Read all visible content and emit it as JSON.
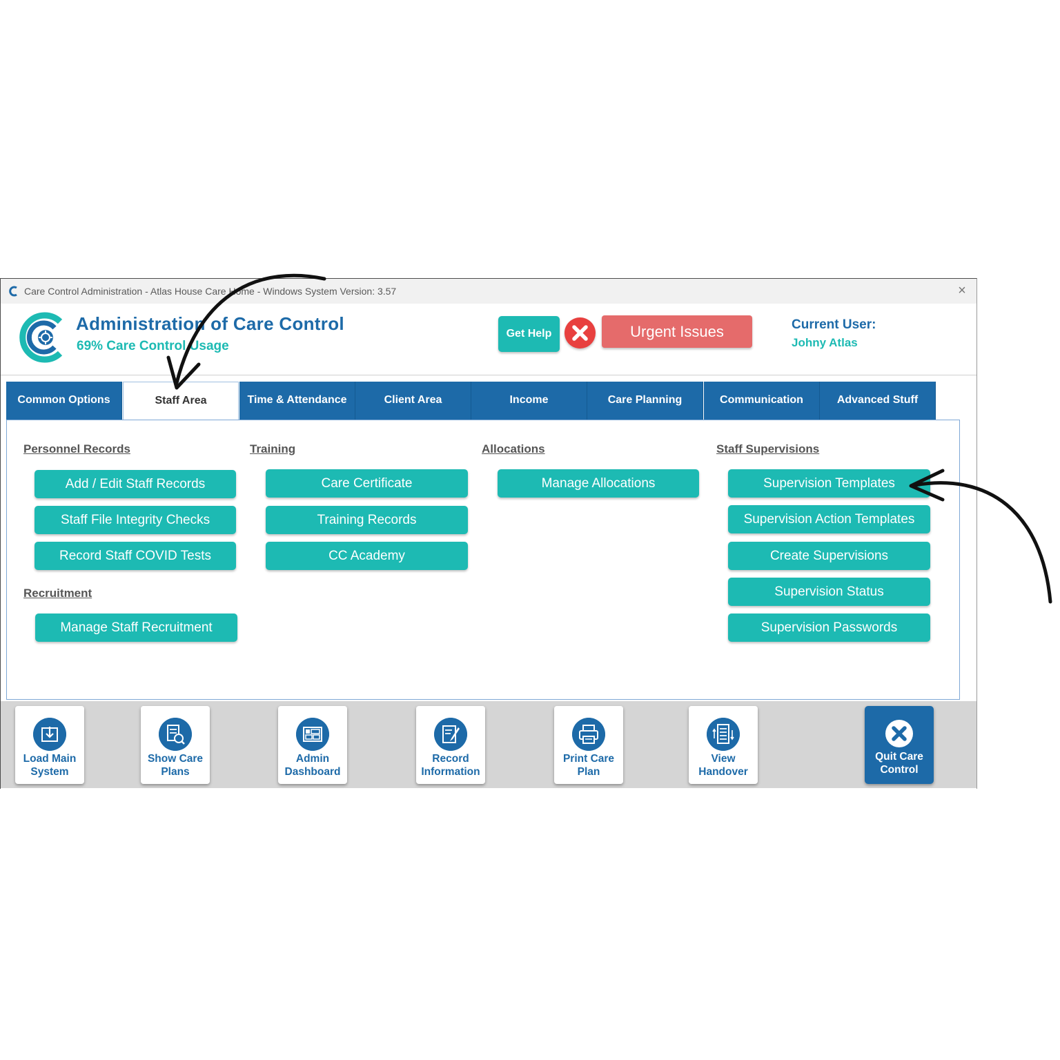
{
  "window": {
    "title": "Care Control Administration - Atlas House Care Home - Windows System Version: 3.57",
    "close_glyph": "×"
  },
  "header": {
    "app_title": "Administration of Care Control",
    "usage": "69% Care Control Usage",
    "get_help": "Get Help",
    "urgent": "Urgent Issues",
    "current_user_label": "Current User:",
    "current_user_name": "Johny Atlas"
  },
  "tabs": [
    {
      "label": "Common Options",
      "active": false
    },
    {
      "label": "Staff Area",
      "active": true
    },
    {
      "label": "Time & Attendance",
      "active": false
    },
    {
      "label": "Client Area",
      "active": false
    },
    {
      "label": "Income",
      "active": false
    },
    {
      "label": "Care Planning",
      "active": false
    },
    {
      "label": "Communication",
      "active": false
    },
    {
      "label": "Advanced Stuff",
      "active": false
    }
  ],
  "sections": {
    "personnel": {
      "heading": "Personnel Records",
      "buttons": [
        "Add / Edit Staff Records",
        "Staff File Integrity Checks",
        "Record Staff COVID Tests"
      ]
    },
    "recruitment": {
      "heading": "Recruitment",
      "buttons": [
        "Manage Staff Recruitment"
      ]
    },
    "training": {
      "heading": "Training",
      "buttons": [
        "Care Certificate",
        "Training Records",
        "CC Academy"
      ]
    },
    "allocations": {
      "heading": "Allocations",
      "buttons": [
        "Manage Allocations"
      ]
    },
    "supervisions": {
      "heading": "Staff Supervisions",
      "buttons": [
        "Supervision Templates",
        "Supervision Action Templates",
        "Create Supervisions",
        "Supervision Status",
        "Supervision Passwords"
      ]
    }
  },
  "footer": {
    "buttons": [
      {
        "line1": "Load Main",
        "line2": "System",
        "icon": "download-icon"
      },
      {
        "line1": "Show Care",
        "line2": "Plans",
        "icon": "document-search-icon"
      },
      {
        "line1": "Admin",
        "line2": "Dashboard",
        "icon": "dashboard-icon"
      },
      {
        "line1": "Record",
        "line2": "Information",
        "icon": "edit-document-icon"
      },
      {
        "line1": "Print Care",
        "line2": "Plan",
        "icon": "printer-icon"
      },
      {
        "line1": "View",
        "line2": "Handover",
        "icon": "list-icon"
      }
    ],
    "quit": {
      "line1": "Quit Care",
      "line2": "Control",
      "icon": "close-icon"
    }
  },
  "colors": {
    "brand_blue": "#1d6aa8",
    "teal": "#1dbab3",
    "urgent_red": "#e56b6b",
    "alert_red": "#e8403f"
  }
}
